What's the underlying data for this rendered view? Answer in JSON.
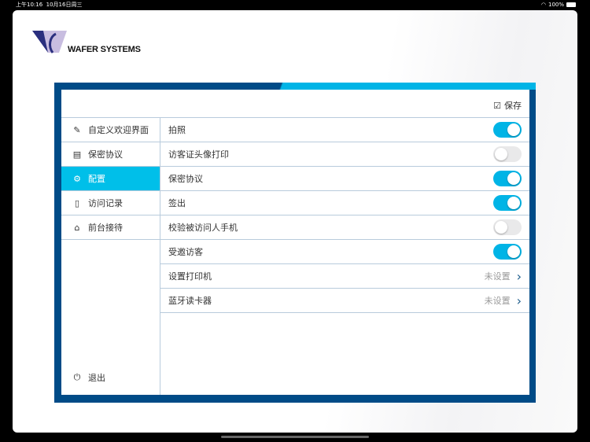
{
  "status": {
    "time": "上午10:16",
    "date": "10月16日周三",
    "battery": "100%"
  },
  "brand": {
    "name": "WAFER SYSTEMS"
  },
  "header": {
    "save_label": "保存"
  },
  "sidebar": {
    "items": [
      {
        "label": "自定义欢迎界面",
        "icon": "edit-icon"
      },
      {
        "label": "保密协议",
        "icon": "clipboard-icon"
      },
      {
        "label": "配置",
        "icon": "gear-icon",
        "active": true
      },
      {
        "label": "访问记录",
        "icon": "document-icon"
      },
      {
        "label": "前台接待",
        "icon": "reception-bell-icon"
      }
    ],
    "logout": "退出"
  },
  "settings": [
    {
      "label": "拍照",
      "on": true
    },
    {
      "label": "访客证头像打印",
      "on": false
    },
    {
      "label": "保密协议",
      "on": true
    },
    {
      "label": "签出",
      "on": true
    },
    {
      "label": "校验被访问人手机",
      "on": false
    },
    {
      "label": "受邀访客",
      "on": true
    },
    {
      "label": "设置打印机",
      "value": "未设置"
    },
    {
      "label": "蓝牙读卡器",
      "value": "未设置"
    }
  ],
  "colors": {
    "accent": "#00b4e6",
    "frame": "#004b87"
  }
}
